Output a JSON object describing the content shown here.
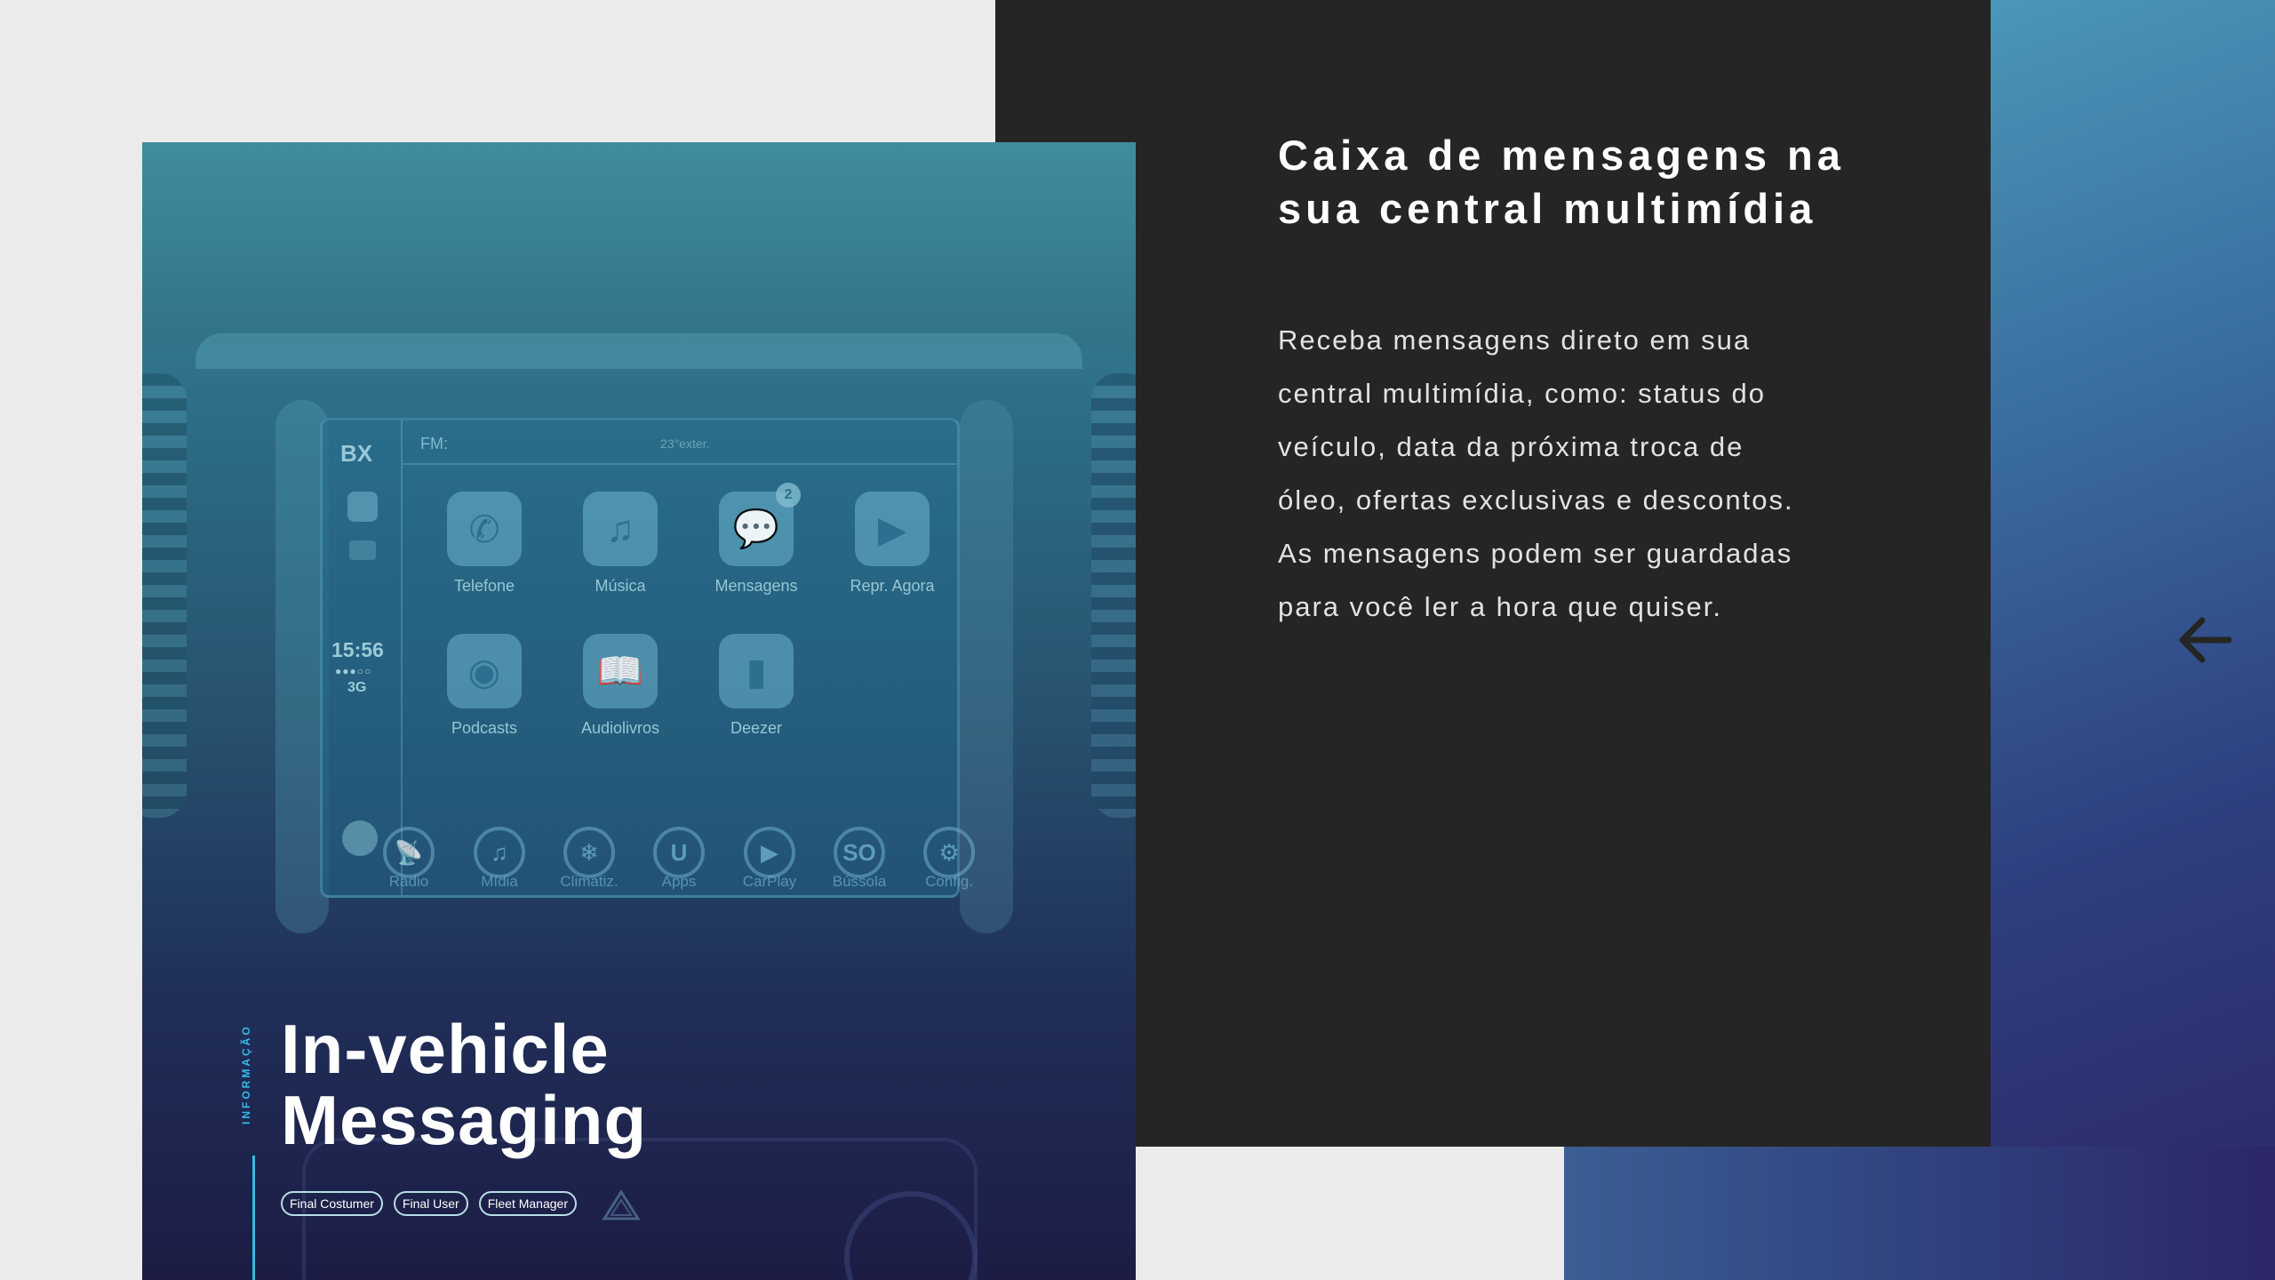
{
  "colors": {
    "page_background": "#ebebeb",
    "dark_panel": "#252525",
    "accent_cyan": "#34b9e6",
    "gradient_top": "#4fa6bf",
    "gradient_bottom": "#2c2663"
  },
  "info_panel": {
    "title_line1": "Caixa de mensagens na",
    "title_line2": "sua central multimídia",
    "body": "Receba mensagens direto em sua\ncentral multimídia, como: status do\nveículo, data da próxima troca de\nóleo, ofertas exclusivas e descontos.\nAs mensagens podem ser guardadas\npara você ler a hora que quiser."
  },
  "navigation": {
    "back_icon": "arrow-left-icon"
  },
  "hero": {
    "category": "INFORMAÇÃO",
    "title_line1": "In-vehicle",
    "title_line2": "Messaging",
    "tags": [
      "Final Costumer",
      "Final User",
      "Fleet Manager"
    ]
  },
  "infotainment": {
    "brand": "BX",
    "radio": "FM:",
    "temperature": "23°exter.",
    "time": "15:56",
    "signal_dots": "●●●○○",
    "network": "3G",
    "apps": [
      {
        "label": "Telefone",
        "icon": "phone-icon",
        "glyph": "✆"
      },
      {
        "label": "Música",
        "icon": "music-icon",
        "glyph": "♫"
      },
      {
        "label": "Mensagens",
        "icon": "message-icon",
        "glyph": "💬",
        "badge": "2"
      },
      {
        "label": "Repr. Agora",
        "icon": "play-icon",
        "glyph": "▶"
      },
      {
        "label": "Podcasts",
        "icon": "podcast-icon",
        "glyph": "◉"
      },
      {
        "label": "Audiolivros",
        "icon": "book-icon",
        "glyph": "📖"
      },
      {
        "label": "Deezer",
        "icon": "equalizer-icon",
        "glyph": "▮"
      }
    ],
    "dock": [
      {
        "label": "Rádio",
        "icon": "radio-icon",
        "glyph": "📡"
      },
      {
        "label": "Mídia",
        "icon": "media-icon",
        "glyph": "♫"
      },
      {
        "label": "Climatiz.",
        "icon": "climate-icon",
        "glyph": "❄"
      },
      {
        "label": "Apps",
        "icon": "apps-icon",
        "glyph": "U"
      },
      {
        "label": "CarPlay",
        "icon": "carplay-icon",
        "glyph": "▶"
      },
      {
        "label": "Bússola",
        "icon": "compass-icon",
        "glyph": "SO"
      },
      {
        "label": "Config.",
        "icon": "settings-icon",
        "glyph": "⚙"
      }
    ]
  }
}
